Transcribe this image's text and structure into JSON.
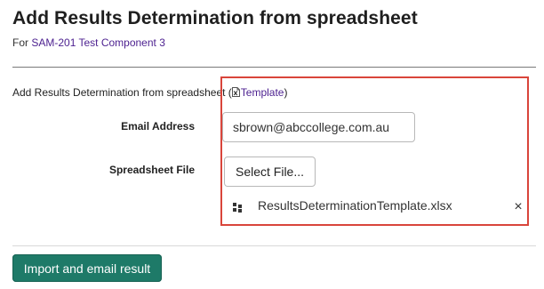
{
  "page": {
    "title": "Add Results Determination from spreadsheet",
    "subtitle_prefix": "For ",
    "subtitle_link": "SAM-201 Test Component 3"
  },
  "intro": {
    "text": "Add Results Determination from spreadsheet (",
    "template_link": "Template",
    "close_paren": ")",
    "template_icon": "excel-file-icon"
  },
  "form": {
    "email_label": "Email Address",
    "email_value": "sbrown@abccollege.com.au",
    "file_label": "Spreadsheet File",
    "select_file_label": "Select File...",
    "selected_file": {
      "name": "ResultsDeterminationTemplate.xlsx",
      "icon": "file-grid-icon",
      "remove_icon": "close-icon",
      "remove_glyph": "×"
    }
  },
  "actions": {
    "submit_label": "Import and email result"
  },
  "colors": {
    "link": "#4b1f8f",
    "primary_button": "#1e7a68",
    "highlight_border": "#d9453b"
  }
}
